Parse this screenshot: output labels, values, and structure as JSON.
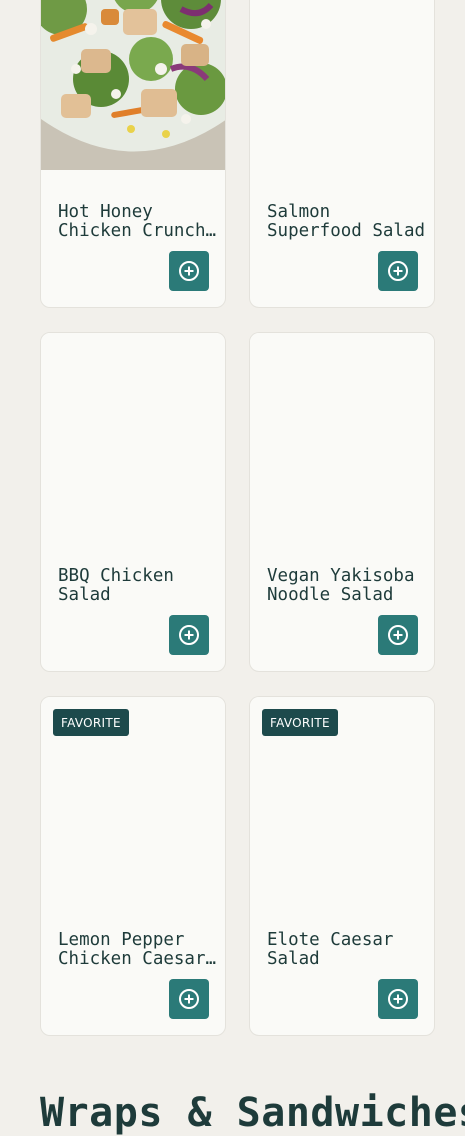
{
  "products": [
    {
      "name": "Hot Honey Chicken Crunch Salad",
      "badge": "",
      "has_image": true
    },
    {
      "name": "Salmon Superfood Salad",
      "badge": "",
      "has_image": false
    },
    {
      "name": "BBQ Chicken Salad",
      "badge": "",
      "has_image": false
    },
    {
      "name": "Vegan Yakisoba Noodle Salad",
      "badge": "",
      "has_image": false
    },
    {
      "name": "Lemon Pepper Chicken Caesar Salad",
      "badge": "FAVORITE",
      "has_image": false
    },
    {
      "name": "Elote Caesar Salad",
      "badge": "FAVORITE",
      "has_image": false
    }
  ],
  "add_button_icon": "plus-circle-icon",
  "next_section": {
    "title": "Wraps & Sandwiches"
  },
  "colors": {
    "page_background": "#f2f0eb",
    "card_background": "#fafaf7",
    "accent": "#2b7a78",
    "badge_background": "#1d4a4c",
    "text": "#1e3b3a"
  }
}
